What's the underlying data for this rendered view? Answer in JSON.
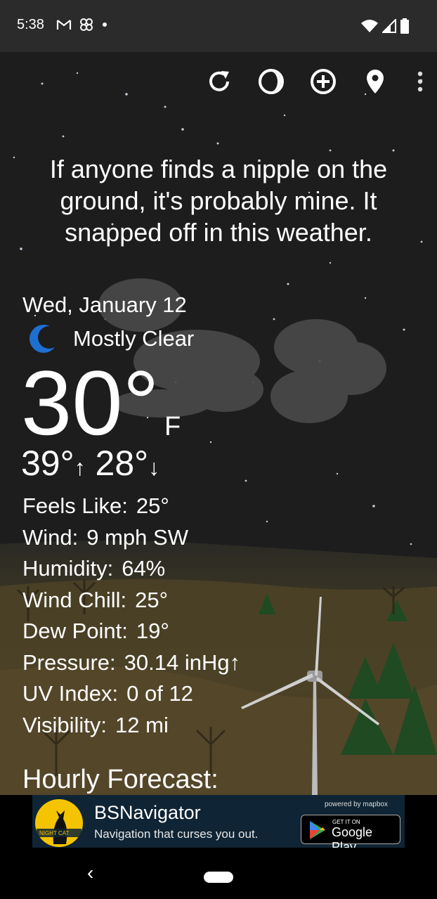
{
  "status_bar": {
    "time": "5:38",
    "left_icons": [
      "gmail-icon",
      "pinwheel-icon",
      "dot-icon"
    ],
    "right_icons": [
      "wifi-icon",
      "signal-icon",
      "battery-icon"
    ]
  },
  "toolbar": {
    "icons": [
      "refresh-icon",
      "moon-phase-icon",
      "add-location-icon",
      "location-pin-icon",
      "more-vert-icon"
    ]
  },
  "quote": "If anyone finds a nipple on the ground, it's probably mine. It snapped off in this weather.",
  "current": {
    "date": "Wed, January 12",
    "condition": "Mostly Clear",
    "condition_icon": "moon-icon",
    "temp": "30°",
    "unit": "F",
    "high": "39°",
    "low": "28°"
  },
  "details": [
    {
      "label": "Feels Like:",
      "value": "25°"
    },
    {
      "label": "Wind:",
      "value": "9 mph SW"
    },
    {
      "label": "Humidity:",
      "value": "64%"
    },
    {
      "label": "Wind Chill:",
      "value": "25°"
    },
    {
      "label": "Dew Point:",
      "value": "19°"
    },
    {
      "label": "Pressure:",
      "value": "30.14 inHg↑"
    },
    {
      "label": "UV Index:",
      "value": "0 of 12"
    },
    {
      "label": "Visibility:",
      "value": "12 mi"
    }
  ],
  "hourly_title": "Hourly Forecast:",
  "ad": {
    "title": "BSNavigator",
    "subtitle": "Navigation that curses you out.",
    "powered_by": "powered by mapbox",
    "play_get": "GET IT ON",
    "play_store": "Google Play",
    "logo_text": "NIGHT CAT"
  },
  "colors": {
    "sky": "#1d1d1d",
    "status_bar": "#2b2b2b",
    "moon_blue": "#1e6fd0",
    "ad_bg": "#0f2434"
  }
}
